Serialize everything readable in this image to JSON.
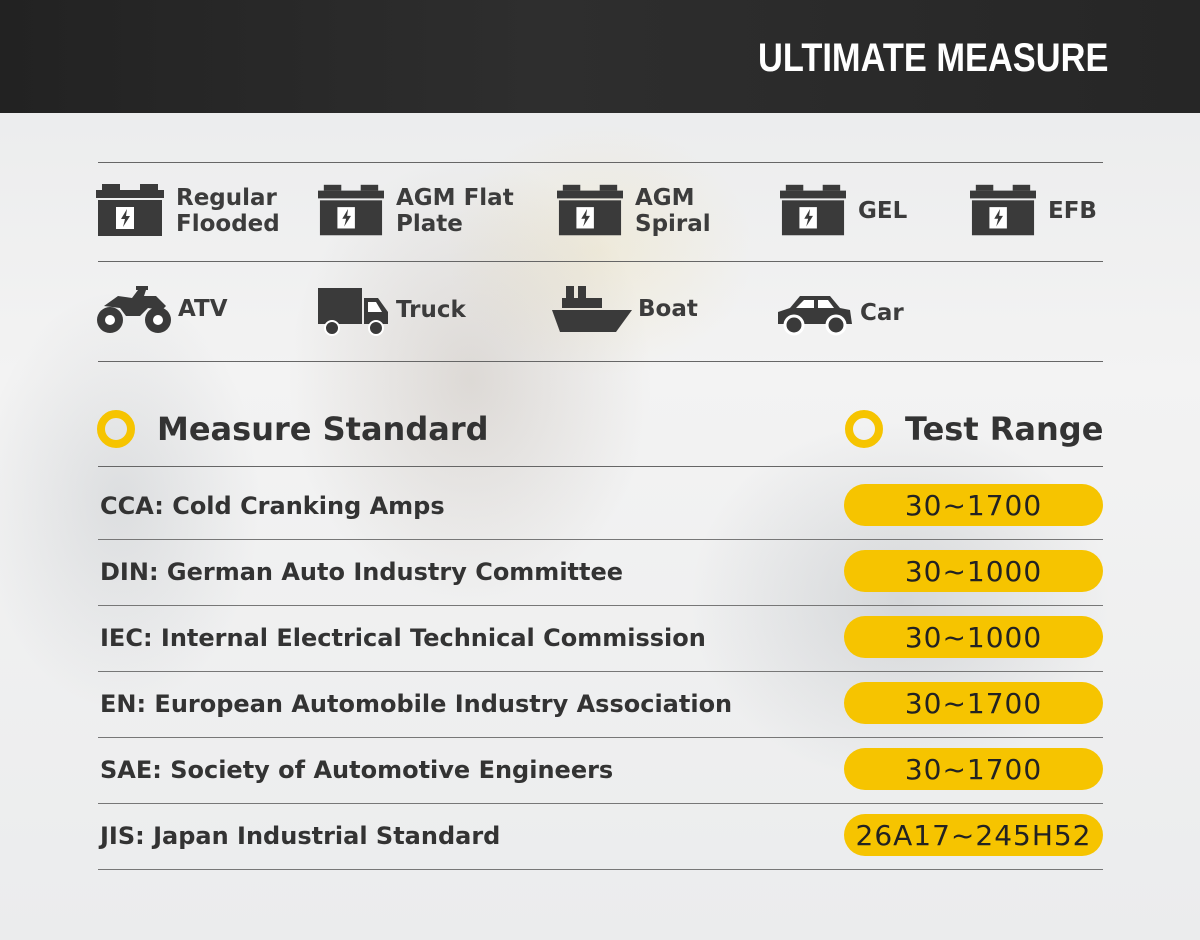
{
  "header": {
    "title": "ULTIMATE MEASURE"
  },
  "battery_types": [
    {
      "label": "Regular\nFlooded",
      "icon": "battery-icon"
    },
    {
      "label": "AGM Flat\nPlate",
      "icon": "battery-icon"
    },
    {
      "label": "AGM\nSpiral",
      "icon": "battery-icon"
    },
    {
      "label": "GEL",
      "icon": "battery-icon"
    },
    {
      "label": "EFB",
      "icon": "battery-icon"
    }
  ],
  "vehicles": [
    {
      "label": "ATV",
      "icon": "atv-icon"
    },
    {
      "label": "Truck",
      "icon": "truck-icon"
    },
    {
      "label": "Boat",
      "icon": "boat-icon"
    },
    {
      "label": "Car",
      "icon": "car-icon"
    }
  ],
  "table": {
    "col1_header": "Measure Standard",
    "col2_header": "Test Range",
    "rows": [
      {
        "standard": "CCA: Cold Cranking Amps",
        "range": "30~1700"
      },
      {
        "standard": "DIN: German Auto Industry Committee",
        "range": "30~1000"
      },
      {
        "standard": "IEC: Internal Electrical Technical Commission",
        "range": "30~1000"
      },
      {
        "standard": "EN: European Automobile Industry Association",
        "range": "30~1700"
      },
      {
        "standard": "SAE: Society of Automotive Engineers",
        "range": "30~1700"
      },
      {
        "standard": "JIS: Japan Industrial Standard",
        "range": "26A17~245H52"
      }
    ]
  },
  "colors": {
    "accent": "#f6c400",
    "header_bg": "#262626",
    "icon": "#3a3a3a"
  }
}
